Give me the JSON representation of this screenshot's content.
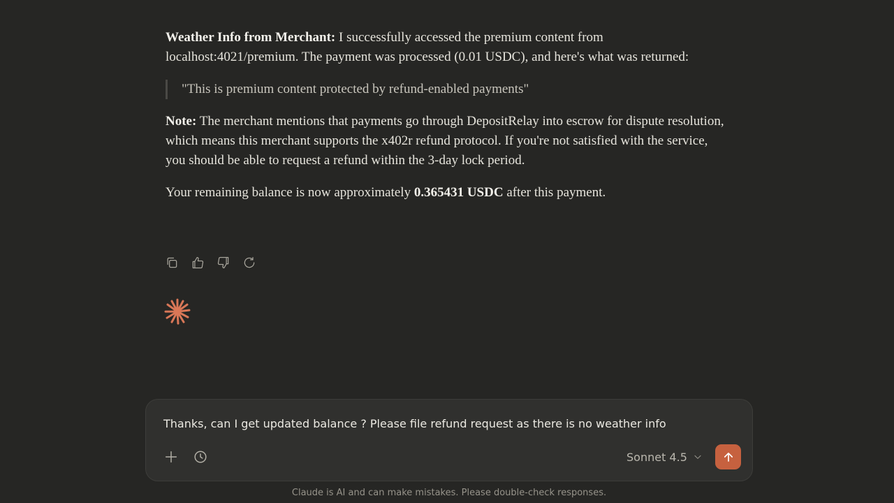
{
  "message": {
    "p1_bold": "Weather Info from Merchant:",
    "p1_text": " I successfully accessed the premium content from localhost:4021/premium. The payment was processed (0.01 USDC), and here's what was returned:",
    "quote": "\"This is premium content protected by refund-enabled payments\"",
    "p3_bold": "Note:",
    "p3_text": " The merchant mentions that payments go through DepositRelay into escrow for dispute resolution, which means this merchant supports the x402r refund protocol. If you're not satisfied with the service, you should be able to request a refund within the 3-day lock period.",
    "p4_before": "Your remaining balance is now approximately ",
    "p4_bold": "0.365431 USDC",
    "p4_after": " after this payment."
  },
  "actions": {
    "icons": [
      "copy-icon",
      "thumbs-up-icon",
      "thumbs-down-icon",
      "retry-icon"
    ]
  },
  "assistant_logo": "claude-spark-icon",
  "composer": {
    "input_value": "Thanks, can I get updated balance ? Please file refund request as there is no weather info",
    "icons": [
      "plus-icon",
      "history-icon",
      "chevron-down-icon",
      "arrow-up-icon"
    ],
    "model_label": "Sonnet 4.5"
  },
  "colors": {
    "background": "#262624",
    "composer_bg": "#30302e",
    "accent": "#c6613f"
  },
  "footer": {
    "disclaimer": "Claude is AI and can make mistakes. Please double-check responses."
  }
}
